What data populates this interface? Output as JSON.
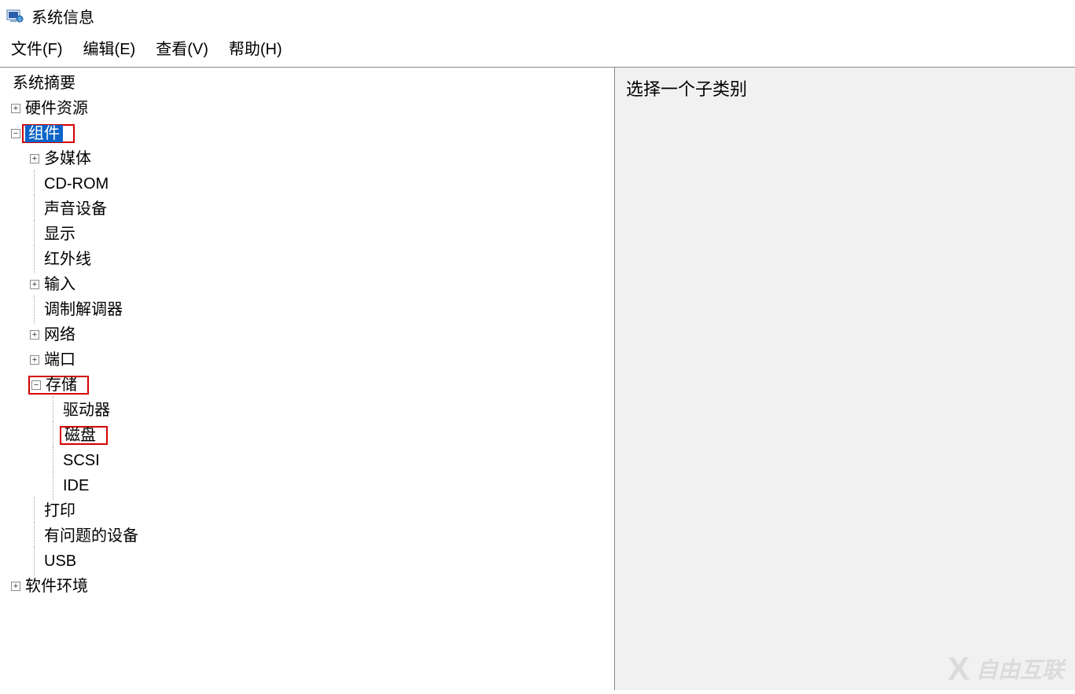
{
  "appTitle": "系统信息",
  "menu": {
    "file": "文件(F)",
    "edit": "编辑(E)",
    "view": "查看(V)",
    "help": "帮助(H)"
  },
  "tree": {
    "systemSummary": "系统摘要",
    "hardwareResources": "硬件资源",
    "components": "组件",
    "multimedia": "多媒体",
    "cdrom": "CD-ROM",
    "soundDevice": "声音设备",
    "display": "显示",
    "infrared": "红外线",
    "input": "输入",
    "modem": "调制解调器",
    "network": "网络",
    "ports": "端口",
    "storage": "存储",
    "drives": "驱动器",
    "disks": "磁盘",
    "scsi": "SCSI",
    "ide": "IDE",
    "printing": "打印",
    "problemDevices": "有问题的设备",
    "usb": "USB",
    "softwareEnvironment": "软件环境"
  },
  "rightPane": {
    "message": "选择一个子类别"
  },
  "watermark": "自由互联",
  "icons": {
    "plus": "+",
    "minus": "−"
  }
}
